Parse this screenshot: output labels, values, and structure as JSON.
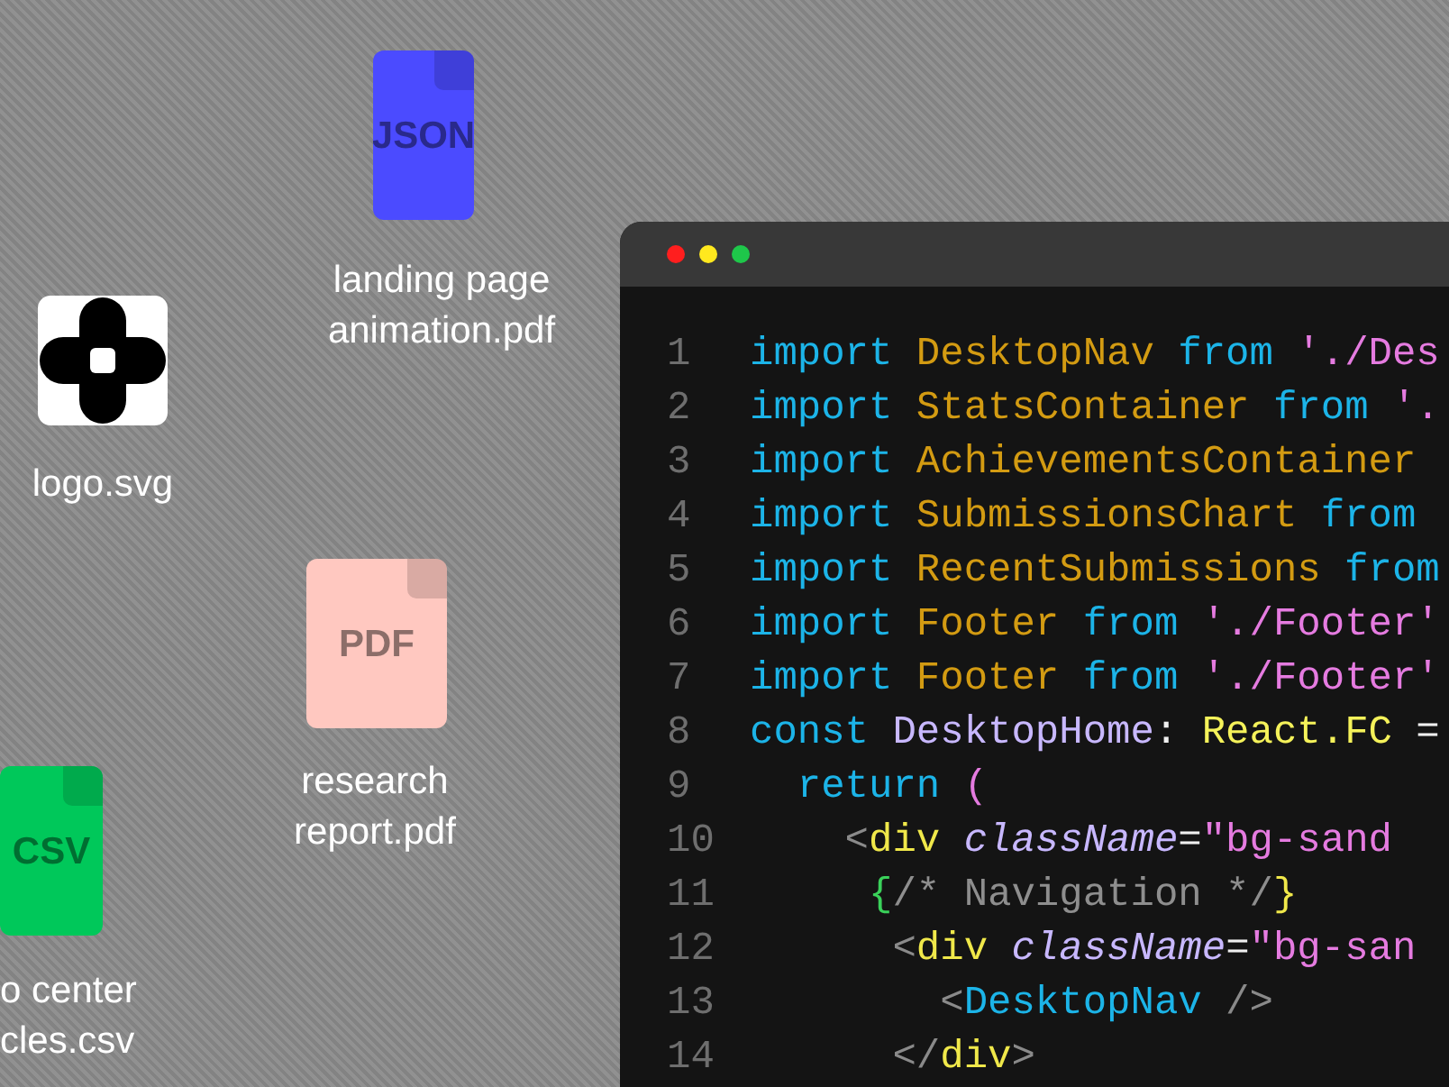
{
  "desktop": {
    "icons": [
      {
        "kind": "file",
        "label": "JSON",
        "color": "#4b4bff",
        "caption": [
          "landing page",
          "animation.pdf"
        ]
      },
      {
        "kind": "logo",
        "caption": [
          "logo.svg"
        ]
      },
      {
        "kind": "file",
        "label": "PDF",
        "color": "#ffc8c0",
        "caption": [
          "research",
          "report.pdf"
        ]
      },
      {
        "kind": "file",
        "label": "CSV",
        "color": "#00c85a",
        "caption": [
          "o center",
          "cles.csv"
        ]
      }
    ]
  },
  "editor": {
    "lines": [
      {
        "number": "1",
        "tokens": [
          {
            "kind": "keyword",
            "text": "import"
          },
          {
            "kind": "name",
            "text": " DesktopNav"
          },
          {
            "kind": "keyword",
            "text": " from"
          },
          {
            "kind": "string",
            "text": " './Des"
          }
        ]
      },
      {
        "number": "2",
        "tokens": [
          {
            "kind": "keyword",
            "text": "import"
          },
          {
            "kind": "name",
            "text": " StatsContainer"
          },
          {
            "kind": "keyword",
            "text": " from"
          },
          {
            "kind": "string",
            "text": " '."
          }
        ]
      },
      {
        "number": "3",
        "tokens": [
          {
            "kind": "keyword",
            "text": "import"
          },
          {
            "kind": "name",
            "text": " AchievementsContainer"
          }
        ]
      },
      {
        "number": "4",
        "tokens": [
          {
            "kind": "keyword",
            "text": "import"
          },
          {
            "kind": "name",
            "text": " SubmissionsChart"
          },
          {
            "kind": "keyword",
            "text": " from"
          }
        ]
      },
      {
        "number": "5",
        "tokens": [
          {
            "kind": "keyword",
            "text": "import"
          },
          {
            "kind": "name",
            "text": " RecentSubmissions"
          },
          {
            "kind": "keyword",
            "text": " from"
          }
        ]
      },
      {
        "number": "6",
        "tokens": [
          {
            "kind": "keyword",
            "text": "import"
          },
          {
            "kind": "name",
            "text": " Footer"
          },
          {
            "kind": "keyword",
            "text": " from"
          },
          {
            "kind": "string",
            "text": " './Footer'"
          }
        ]
      },
      {
        "number": "7",
        "tokens": [
          {
            "kind": "keyword",
            "text": "import"
          },
          {
            "kind": "name",
            "text": " Footer"
          },
          {
            "kind": "keyword",
            "text": " from"
          },
          {
            "kind": "string",
            "text": " './Footer'"
          }
        ]
      },
      {
        "number": "8",
        "tokens": [
          {
            "kind": "keyword",
            "text": "const"
          },
          {
            "kind": "component",
            "text": " DesktopHome"
          },
          {
            "kind": "plain",
            "text": ":"
          },
          {
            "kind": "type",
            "text": " React.FC"
          },
          {
            "kind": "plain",
            "text": " ="
          }
        ]
      },
      {
        "number": "9",
        "tokens": [
          {
            "kind": "keyword",
            "text": "  return"
          },
          {
            "kind": "string",
            "text": " ("
          }
        ]
      },
      {
        "number": "10",
        "tokens": [
          {
            "kind": "punct",
            "text": "    <"
          },
          {
            "kind": "tag",
            "text": "div"
          },
          {
            "kind": "attr",
            "text": " className"
          },
          {
            "kind": "plain",
            "text": "="
          },
          {
            "kind": "string",
            "text": "\"bg-sand"
          }
        ]
      },
      {
        "number": "11",
        "tokens": [
          {
            "kind": "brace",
            "text": "     {"
          },
          {
            "kind": "comment",
            "text": "/* Navigation */"
          },
          {
            "kind": "tag",
            "text": "}"
          }
        ]
      },
      {
        "number": "12",
        "tokens": [
          {
            "kind": "punct",
            "text": "      <"
          },
          {
            "kind": "tag",
            "text": "div"
          },
          {
            "kind": "attr",
            "text": " className"
          },
          {
            "kind": "plain",
            "text": "="
          },
          {
            "kind": "string",
            "text": "\"bg-san"
          }
        ]
      },
      {
        "number": "13",
        "tokens": [
          {
            "kind": "punct",
            "text": "        <"
          },
          {
            "kind": "keyword",
            "text": "DesktopNav"
          },
          {
            "kind": "punct",
            "text": " />"
          }
        ]
      },
      {
        "number": "14",
        "tokens": [
          {
            "kind": "punct",
            "text": "      </"
          },
          {
            "kind": "tag",
            "text": "div"
          },
          {
            "kind": "punct",
            "text": ">"
          }
        ]
      }
    ]
  }
}
